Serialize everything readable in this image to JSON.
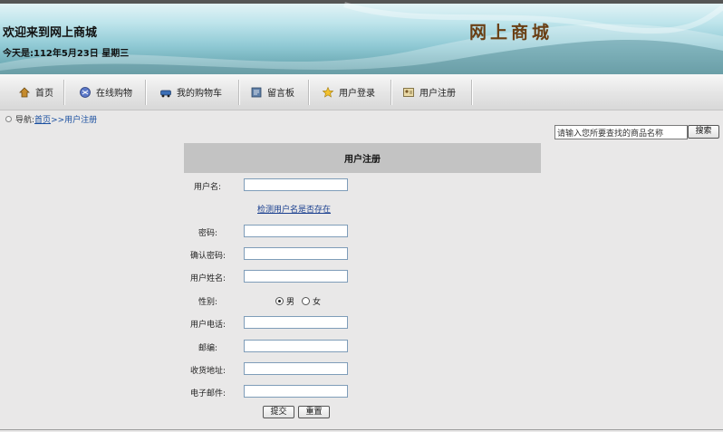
{
  "header": {
    "welcome": "欢迎来到网上商城",
    "date_line": "今天是:112年5月23日 星期三",
    "brand": "网上商城"
  },
  "nav": {
    "items": [
      {
        "label": "首页",
        "icon": "home-icon"
      },
      {
        "label": "在线购物",
        "icon": "online-shopping-icon"
      },
      {
        "label": "我的购物车",
        "icon": "cart-icon"
      },
      {
        "label": "留言板",
        "icon": "message-board-icon"
      },
      {
        "label": "用户登录",
        "icon": "star-icon"
      },
      {
        "label": "用户注册",
        "icon": "register-icon"
      }
    ]
  },
  "breadcrumb": {
    "prefix": "导航:",
    "home": "首页",
    "current": ">>用户注册"
  },
  "search": {
    "value": "请输入您所要查找的商品名称",
    "button": "搜索"
  },
  "form": {
    "title": "用户注册",
    "labels": {
      "username": "用户名:",
      "password": "密码:",
      "confirm_password": "确认密码:",
      "real_name": "用户姓名:",
      "gender": "性别:",
      "phone": "用户电话:",
      "zip": "邮编:",
      "address": "收货地址:",
      "email": "电子邮件:"
    },
    "check_username_link": "检测用户名是否存在",
    "gender_options": {
      "male": "男",
      "female": "女",
      "selected": "男"
    },
    "submit": "提交",
    "reset": "重置"
  },
  "colors": {
    "link": "#1a4fa0",
    "form_header_bg": "#c3c3c3",
    "page_bg": "#e9e8e8",
    "brand_text": "#6a3f14"
  }
}
